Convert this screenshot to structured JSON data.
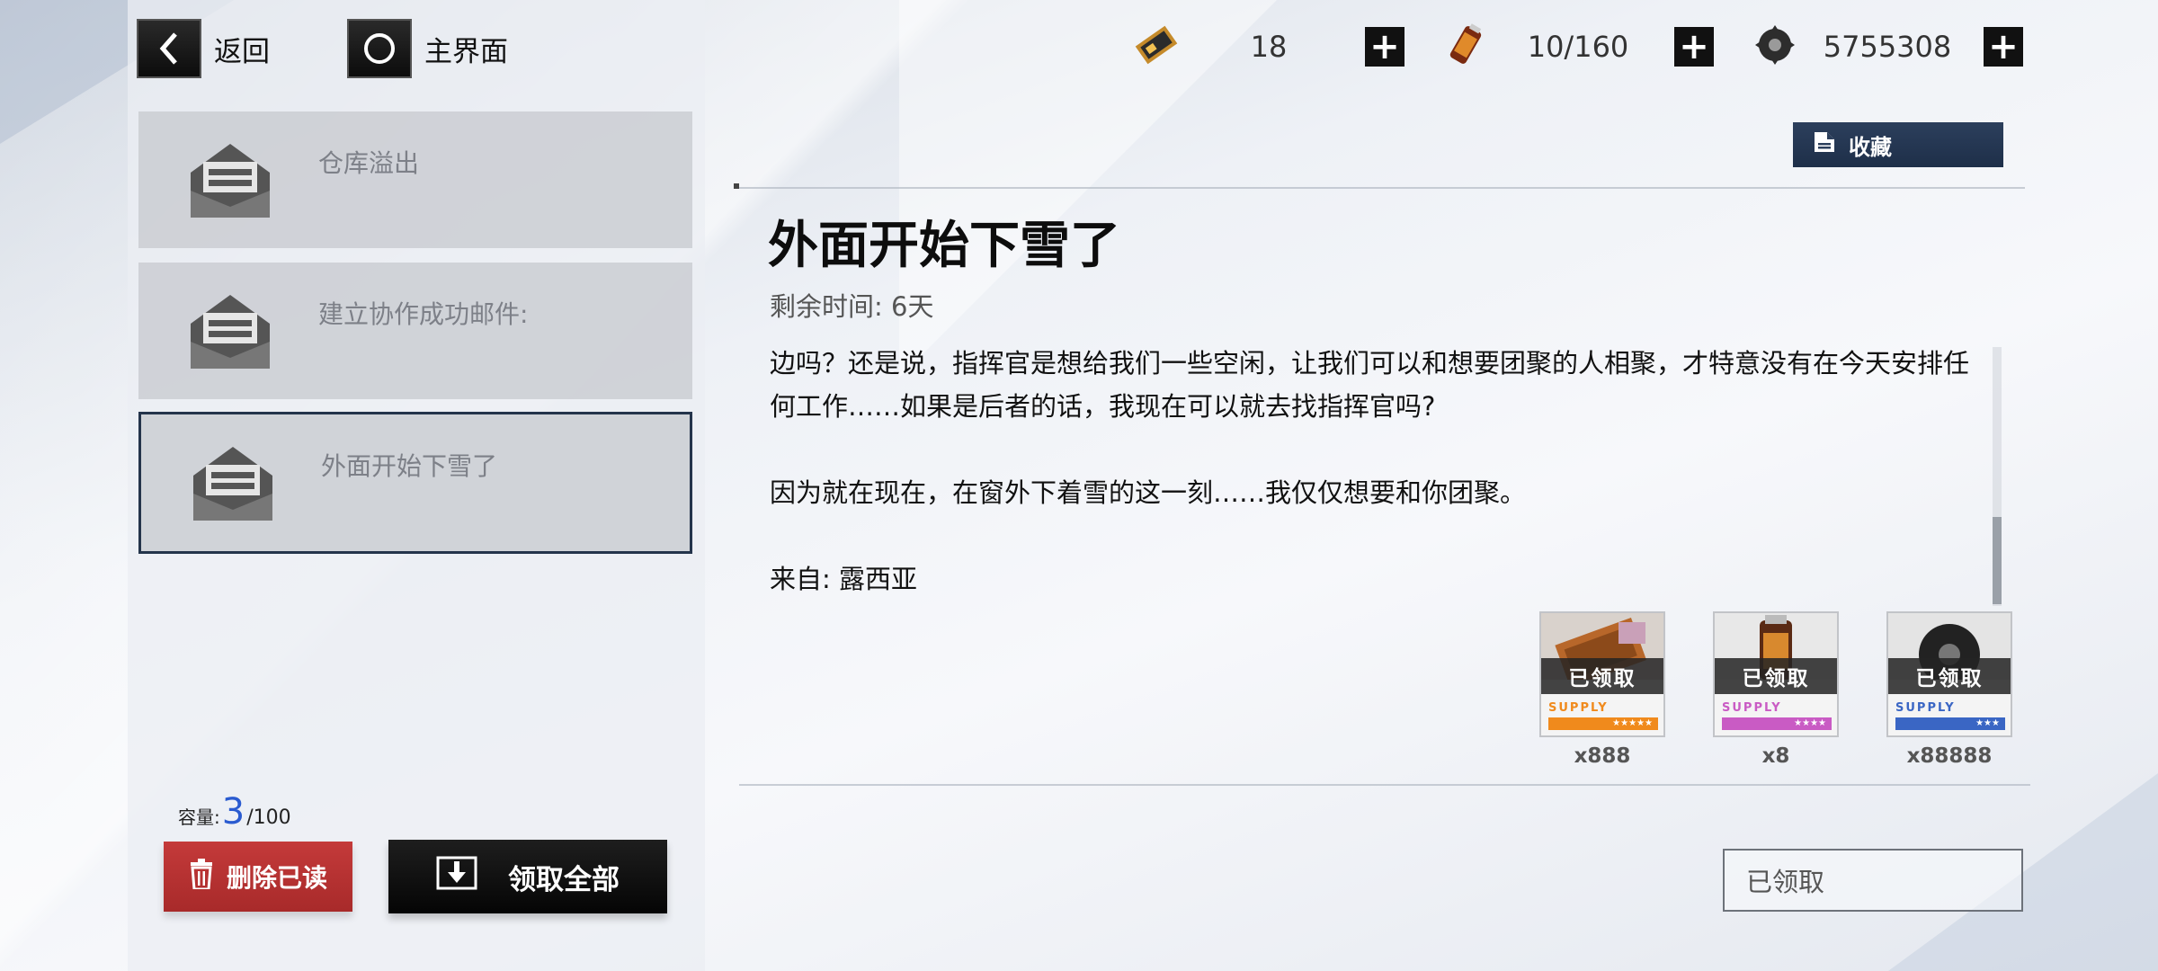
{
  "nav": {
    "back_label": "返回",
    "home_label": "主界面"
  },
  "resources": [
    {
      "icon": "ticket-icon",
      "value": "18"
    },
    {
      "icon": "battery-icon",
      "value": "10/160"
    },
    {
      "icon": "gear-icon",
      "value": "5755308"
    }
  ],
  "mail_list": [
    {
      "title": "仓库溢出"
    },
    {
      "title": "建立协作成功邮件:"
    },
    {
      "title": "外面开始下雪了",
      "selected": true
    }
  ],
  "capacity": {
    "label": "容量:",
    "count": "3",
    "total": "/100"
  },
  "actions": {
    "delete_read": "删除已读",
    "claim_all": "领取全部"
  },
  "detail": {
    "favorite": "收藏",
    "title": "外面开始下雪了",
    "remaining": "剩余时间: 6天",
    "body": [
      "边吗？还是说，指挥官是想给我们一些空闲，让我们可以和想要团聚的人相聚，才特意没有在今天安排任何工作……如果是后者的话，我现在可以就去找指挥官吗?",
      "因为就在现在，在窗外下着雪的这一刻……我仅仅想要和你团聚。",
      "来自: 露西亚"
    ],
    "rewards": [
      {
        "icon": "ticket-icon",
        "status": "已领取",
        "tag": "SUPPLY",
        "stars": "★★★★★",
        "color": "#f08a1c",
        "qty": "x888"
      },
      {
        "icon": "battery-icon",
        "status": "已领取",
        "tag": "SUPPLY",
        "stars": "★★★★",
        "color": "#c95bc4",
        "qty": "x8"
      },
      {
        "icon": "gear-icon",
        "status": "已领取",
        "tag": "SUPPLY",
        "stars": "★★★",
        "color": "#3a66c4",
        "qty": "x88888"
      }
    ],
    "claim_status": "已领取"
  }
}
